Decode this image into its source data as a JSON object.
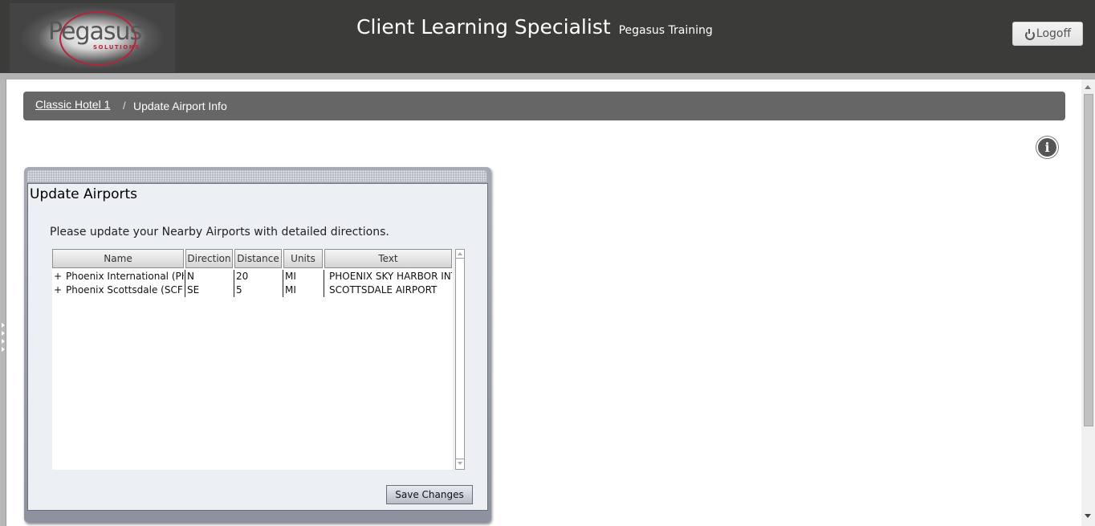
{
  "header": {
    "logo_text": "Pegasus",
    "logo_subtext": "SOLUTIONS",
    "title": "Client Learning Specialist",
    "subtitle": "Pegasus Training",
    "logoff_label": "Logoff",
    "logoff_icon": "power-icon"
  },
  "breadcrumb": {
    "items": [
      {
        "label": "Classic Hotel 1",
        "link": true
      },
      {
        "label": "Update Airport Info",
        "link": false
      }
    ],
    "separator": "/"
  },
  "info_icon": "i",
  "panel": {
    "title": "Update Airports",
    "description": "Please update your Nearby Airports with detailed directions.",
    "columns": [
      "Name",
      "Direction",
      "Distance",
      "Units",
      "Text"
    ],
    "rows": [
      {
        "expander": "+",
        "name": "Phoenix International (PHX)",
        "direction": "N",
        "distance": "20",
        "units": "MI",
        "text": "PHOENIX SKY HARBOR INTL"
      },
      {
        "expander": "+",
        "name": "Phoenix Scottsdale (SCF)",
        "direction": "SE",
        "distance": "5",
        "units": "MI",
        "text": "SCOTTSDALE AIRPORT"
      }
    ],
    "save_label": "Save Changes"
  },
  "colors": {
    "header_bg": "#3b3b3a",
    "breadcrumb_bg": "#666666",
    "logo_accent": "#b3253a",
    "panel_bg": "#eceff4"
  }
}
